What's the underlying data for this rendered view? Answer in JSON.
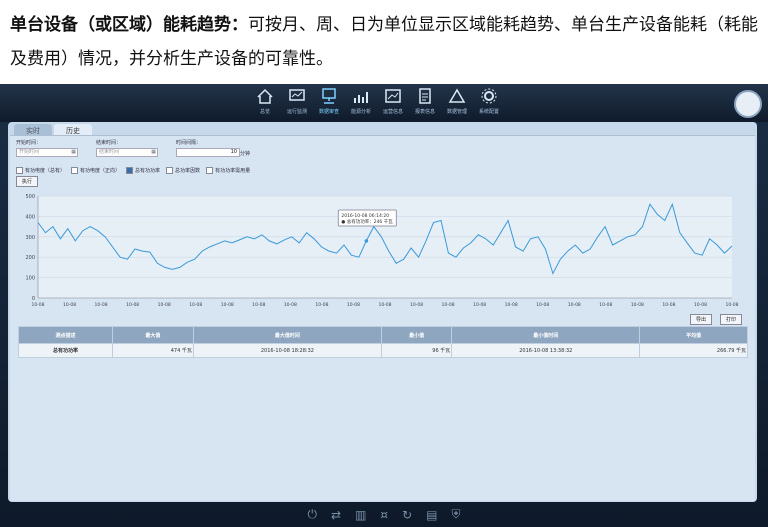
{
  "caption": {
    "bold": "单台设备（或区域）能耗趋势：",
    "rest": "可按月、周、日为单位显示区域能耗趋势、单台生产设备能耗（耗能及费用）情况，并分析生产设备的可靠性。"
  },
  "nav": [
    {
      "icon": "home-icon",
      "label": "总览"
    },
    {
      "icon": "monitor-icon",
      "label": "运行监测"
    },
    {
      "icon": "data-query-icon",
      "label": "数据审查"
    },
    {
      "icon": "energy-analysis-icon",
      "label": "能源分析"
    },
    {
      "icon": "trend-icon",
      "label": "运营信息"
    },
    {
      "icon": "report-icon",
      "label": "报表信息"
    },
    {
      "icon": "data-manage-icon",
      "label": "数据管理"
    },
    {
      "icon": "settings-icon",
      "label": "系统配置"
    }
  ],
  "tabs": [
    "实时",
    "历史"
  ],
  "form": {
    "start_label": "开始时间：",
    "start_placeholder": "开始时间",
    "end_label": "结束时间：",
    "end_placeholder": "结束时间",
    "interval_label": "时间间隔：",
    "interval_value": "10",
    "interval_unit": "分钟",
    "checks": [
      {
        "label": "有功电度（总有）",
        "on": false
      },
      {
        "label": "有功电度（正向）",
        "on": false
      },
      {
        "label": "总有功功率",
        "on": true
      },
      {
        "label": "总功率因数",
        "on": false
      },
      {
        "label": "有功功率需用量",
        "on": false
      }
    ],
    "run_label": "执行"
  },
  "chart_data": {
    "type": "line",
    "ylim": [
      0,
      500
    ],
    "yticks": [
      "0",
      "100",
      "200",
      "300",
      "400",
      "500"
    ],
    "xticks": [
      "10-08",
      "10-08",
      "10-08",
      "10-08",
      "10-08",
      "10-08",
      "10-08",
      "10-08",
      "10-08",
      "10-08",
      "10-08",
      "10-08",
      "10-08",
      "10-08",
      "10-08",
      "10-08",
      "10-08",
      "10-08",
      "10-08",
      "10-08",
      "10-08",
      "10-08",
      "10-08"
    ],
    "values": [
      370,
      320,
      350,
      290,
      340,
      280,
      330,
      350,
      330,
      300,
      250,
      200,
      190,
      240,
      230,
      225,
      170,
      150,
      140,
      150,
      175,
      190,
      230,
      250,
      265,
      280,
      270,
      285,
      300,
      290,
      310,
      280,
      265,
      285,
      300,
      270,
      320,
      290,
      250,
      230,
      220,
      260,
      210,
      200,
      280,
      350,
      300,
      230,
      170,
      190,
      245,
      200,
      280,
      370,
      380,
      220,
      200,
      245,
      270,
      310,
      290,
      260,
      320,
      380,
      250,
      230,
      290,
      300,
      240,
      120,
      190,
      230,
      260,
      220,
      240,
      300,
      350,
      260,
      280,
      300,
      310,
      350,
      460,
      410,
      380,
      460,
      320,
      270,
      220,
      210,
      290,
      260,
      220,
      255
    ],
    "tooltip": {
      "time": "2016-10-08 06:14:20",
      "text": "● 总有功功率：246 千瓦",
      "index": 44
    }
  },
  "actions": {
    "export": "导出",
    "print": "打印"
  },
  "table": {
    "headers": [
      "测点描述",
      "最大值",
      "最大值时间",
      "最小值",
      "最小值时间",
      "平均值"
    ],
    "rows": [
      [
        "总有功功率",
        "474 千瓦",
        "2016-10-08 18:28:32",
        "96 千瓦",
        "2016-10-08 13:38:32",
        "266.79 千瓦"
      ]
    ]
  },
  "bottom_icons": [
    "power-icon",
    "switch-icon",
    "chart-icon",
    "money-icon",
    "refresh-icon",
    "building-icon",
    "shield-icon"
  ]
}
